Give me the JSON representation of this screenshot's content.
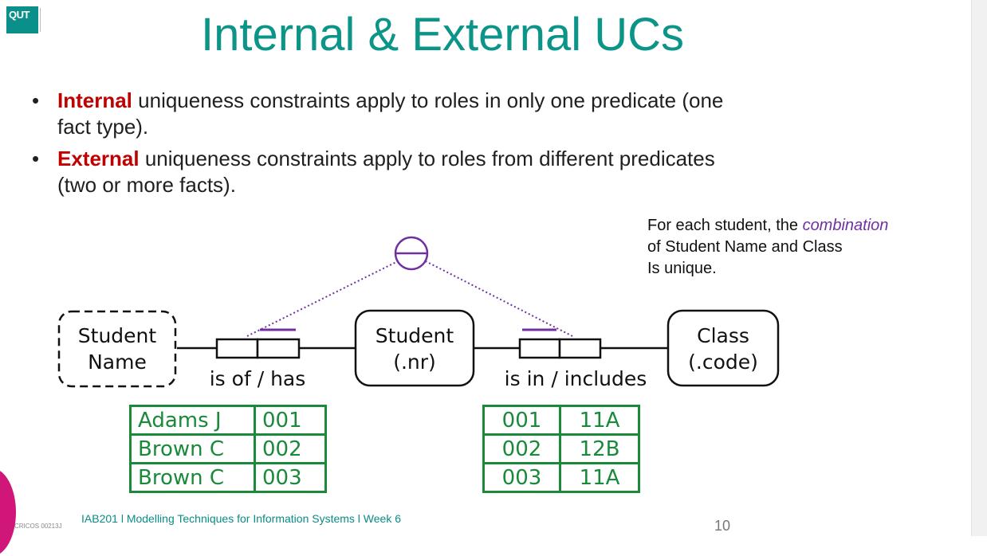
{
  "title": "Internal & External UCs",
  "logo": {
    "text": "QUT"
  },
  "bullets": [
    {
      "keyword": "Internal",
      "line1": " uniqueness constraints apply to roles in only one predicate (one",
      "line2": "fact type)."
    },
    {
      "keyword": "External",
      "line1": " uniqueness constraints apply to roles from different predicates",
      "line2": "(two or more facts)."
    }
  ],
  "note": {
    "prefix": "For each student, the ",
    "emphasis": "combination",
    "line2": "of Student Name and Class",
    "line3": "Is unique."
  },
  "diagram": {
    "entity_student_name": [
      "Student",
      "Name"
    ],
    "entity_student": [
      "Student",
      "(.nr)"
    ],
    "entity_class": [
      "Class",
      "(.code)"
    ],
    "fact1_reading": "is of / has",
    "fact2_reading": "is in / includes",
    "fact1_rows": [
      [
        "Adams J",
        "001"
      ],
      [
        "Brown C",
        "002"
      ],
      [
        "Brown C",
        "003"
      ]
    ],
    "fact2_rows": [
      [
        "001",
        "11A"
      ],
      [
        "002",
        "12B"
      ],
      [
        "003",
        "11A"
      ]
    ],
    "colors": {
      "constraint": "#7030a0",
      "population": "#1a8a3a",
      "title": "#0b9488",
      "keyword": "#c00000"
    }
  },
  "footer": {
    "course": "IAB201 l  Modelling Techniques for Information Systems  l Week 6",
    "page": "10",
    "cricos": "CRICOS 00213J"
  }
}
